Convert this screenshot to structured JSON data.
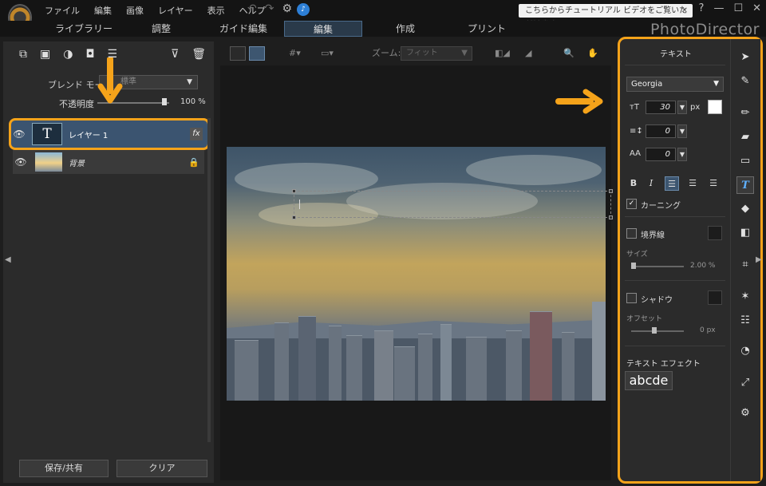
{
  "menu": [
    "ファイル",
    "編集",
    "画像",
    "レイヤー",
    "表示",
    "ヘルプ"
  ],
  "notification": "こちらからチュートリアル ビデオをご覧いただけます。",
  "window_buttons": [
    "?",
    "—",
    "☐",
    "✕"
  ],
  "mode_tabs": [
    "ライブラリー",
    "調整",
    "ガイド編集",
    "編集",
    "作成",
    "プリント"
  ],
  "active_mode": "編集",
  "brand": "PhotoDirector",
  "left_panel": {
    "blend_mode_label": "ブレンド モード:",
    "blend_mode_value": "標準",
    "opacity_label": "不透明度",
    "opacity_value": "100 %",
    "opacity_fraction": 0.93,
    "layers": [
      {
        "name": "レイヤー 1",
        "thumb": "T",
        "fx": "fx",
        "selected": true
      },
      {
        "name": "背景",
        "selected": false
      }
    ],
    "buttons": {
      "save": "保存/共有",
      "clear": "クリア"
    }
  },
  "canvas_toolbar": {
    "zoom_label": "ズーム:",
    "zoom_value": "フィット"
  },
  "right_panel": {
    "title": "テキスト",
    "font": "Georgia",
    "font_size": "30",
    "font_size_unit": "px",
    "line_spacing": "0",
    "char_spacing": "0",
    "style_buttons": [
      "B",
      "I"
    ],
    "kerning_label": "カーニング",
    "kerning_checked": true,
    "border_label": "境界線",
    "border_checked": false,
    "size_label": "サイズ",
    "size_value": "2.00 %",
    "shadow_label": "シャドウ",
    "shadow_checked": false,
    "offset_label": "オフセット",
    "offset_value": "0 px",
    "effect_label": "テキスト エフェクト",
    "effect_sample": "abcde"
  },
  "tools": [
    "select-arrow",
    "brush-stamp",
    "pen",
    "eraser",
    "rectangle",
    "text",
    "fill-bucket",
    "gradient",
    "crop",
    "magic-wand",
    "sliders",
    "timer-pie",
    "transform",
    "settings-gear"
  ],
  "annotation_color": "#f5a31a"
}
